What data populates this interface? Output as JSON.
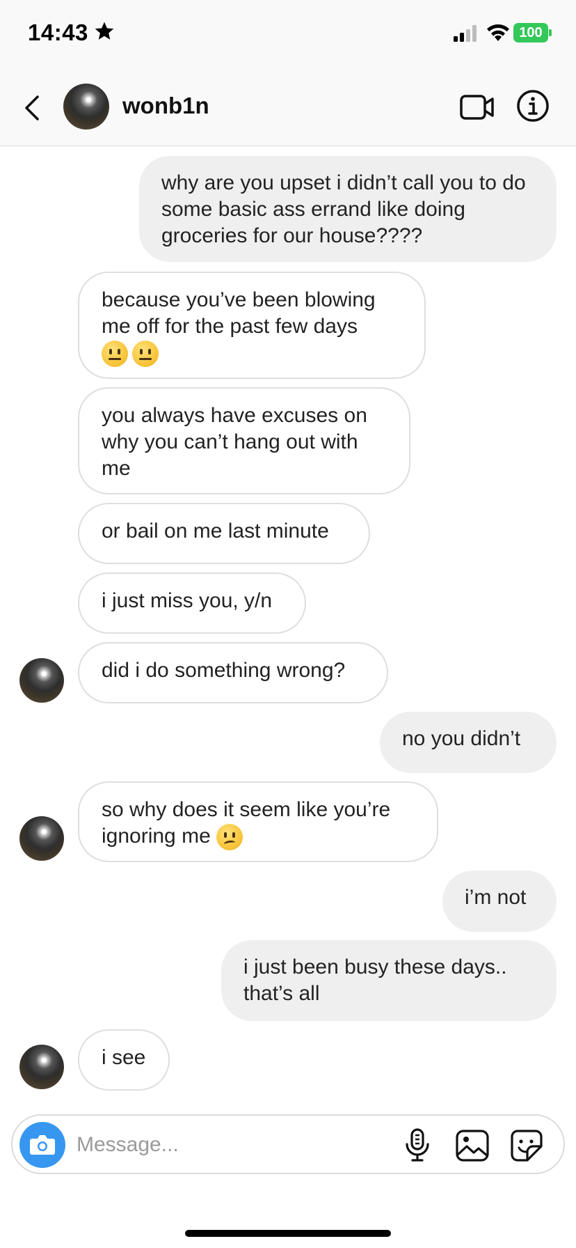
{
  "status_bar": {
    "time": "14:43",
    "battery": "100"
  },
  "header": {
    "username": "wonb1n"
  },
  "messages": [
    {
      "sender": "me",
      "text": "why are you upset i didn’t call you to do some basic ass errand like doing groceries for our house????"
    },
    {
      "sender": "them",
      "text": "because you’ve been blowing me off for the past few days",
      "emoji": [
        "neutral-face",
        "neutral-face"
      ]
    },
    {
      "sender": "them",
      "text": "you always have excuses on why you can’t hang out with me"
    },
    {
      "sender": "them",
      "text": "or bail on me last minute"
    },
    {
      "sender": "them",
      "text": "i just miss you, y/n"
    },
    {
      "sender": "them",
      "text": "did i do something wrong?"
    },
    {
      "sender": "me",
      "text": "no you didn’t"
    },
    {
      "sender": "them",
      "text": "so why does it seem like you’re ignoring me",
      "emoji": [
        "confused-face"
      ]
    },
    {
      "sender": "me",
      "text": "i’m not"
    },
    {
      "sender": "me",
      "text": "i just been busy these days.. that’s all"
    },
    {
      "sender": "them",
      "text": "i see"
    }
  ],
  "composer": {
    "placeholder": "Message..."
  },
  "colors": {
    "accent": "#3797f0",
    "battery": "#34c759",
    "my_bubble": "#efefef"
  },
  "icons": [
    "star-icon",
    "signal-icon",
    "wifi-icon",
    "battery-icon",
    "back-icon",
    "video-call-icon",
    "info-icon",
    "camera-icon",
    "microphone-icon",
    "gallery-icon",
    "sticker-icon"
  ]
}
